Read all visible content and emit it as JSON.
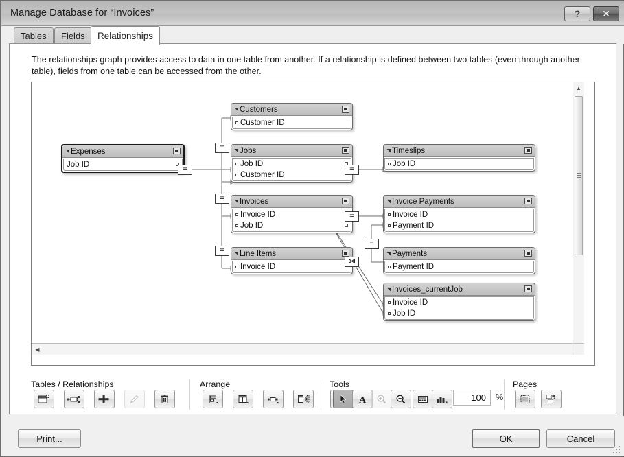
{
  "window": {
    "title": "Manage Database for “Invoices”",
    "help_label": "?",
    "close_label": "✕"
  },
  "tabs": [
    {
      "id": "tables",
      "label": "Tables",
      "active": false
    },
    {
      "id": "fields",
      "label": "Fields",
      "active": false
    },
    {
      "id": "relationships",
      "label": "Relationships",
      "active": true
    }
  ],
  "panel": {
    "description": "The relationships graph provides access to data in one table from another. If a relationship is defined between two tables (even through another table), fields from one table can be accessed from the other."
  },
  "graph": {
    "tables": [
      {
        "name": "Customers",
        "fields": [
          "Customer ID"
        ],
        "selected": false,
        "keyed": []
      },
      {
        "name": "Expenses",
        "fields": [
          "Job ID"
        ],
        "selected": true,
        "keyed": [
          "Job ID"
        ]
      },
      {
        "name": "Jobs",
        "fields": [
          "Job ID",
          "Customer ID"
        ],
        "selected": false,
        "keyed": [
          "Job ID"
        ]
      },
      {
        "name": "Timeslips",
        "fields": [
          "Job ID"
        ],
        "selected": false,
        "keyed": []
      },
      {
        "name": "Invoices",
        "fields": [
          "Invoice ID",
          "Job ID"
        ],
        "selected": false,
        "keyed": [
          "Invoice ID",
          "Job ID"
        ]
      },
      {
        "name": "Invoice Payments",
        "fields": [
          "Invoice ID",
          "Payment ID"
        ],
        "selected": false,
        "keyed": []
      },
      {
        "name": "Line Items",
        "fields": [
          "Invoice ID"
        ],
        "selected": false,
        "keyed": []
      },
      {
        "name": "Payments",
        "fields": [
          "Payment ID"
        ],
        "selected": false,
        "keyed": []
      },
      {
        "name": "Invoices_currentJob",
        "fields": [
          "Invoice ID",
          "Job ID"
        ],
        "selected": false,
        "keyed": []
      }
    ],
    "operators": [
      {
        "id": "op-expenses-jobs",
        "symbol": "="
      },
      {
        "id": "op-jobs-customers",
        "symbol": "="
      },
      {
        "id": "op-jobs-timeslips",
        "symbol": "="
      },
      {
        "id": "op-jobs-invoices",
        "symbol": "="
      },
      {
        "id": "op-invoices-lineitems",
        "symbol": "="
      },
      {
        "id": "op-invoices-invoicepayments",
        "symbol": "="
      },
      {
        "id": "op-invoicepayments-payments",
        "symbol": "="
      },
      {
        "id": "op-invoices-currentjob",
        "symbol": "⋈"
      }
    ]
  },
  "toolbar": {
    "groups": [
      {
        "id": "tables-relationships",
        "label": "Tables / Relationships"
      },
      {
        "id": "arrange",
        "label": "Arrange"
      },
      {
        "id": "tools",
        "label": "Tools"
      },
      {
        "id": "pages",
        "label": "Pages"
      }
    ],
    "buttons": [
      {
        "id": "add-table",
        "icon": "add-table-icon",
        "enabled": true,
        "active": false
      },
      {
        "id": "add-relationship",
        "icon": "add-relationship-icon",
        "enabled": true,
        "active": false
      },
      {
        "id": "duplicate-table",
        "icon": "duplicate-table-icon",
        "enabled": true,
        "active": false
      },
      {
        "id": "edit-table",
        "icon": "pencil-icon",
        "enabled": false,
        "active": false
      },
      {
        "id": "delete-table",
        "icon": "trash-icon",
        "enabled": true,
        "active": false
      },
      {
        "id": "align",
        "icon": "align-icon",
        "enabled": true,
        "active": false
      },
      {
        "id": "distribute",
        "icon": "distribute-icon",
        "enabled": true,
        "active": false
      },
      {
        "id": "resize",
        "icon": "resize-icon",
        "enabled": true,
        "active": false
      },
      {
        "id": "arrange-tables",
        "icon": "arrange-tables-icon",
        "enabled": true,
        "active": false
      },
      {
        "id": "color",
        "icon": "color-swatch-icon",
        "enabled": true,
        "active": false
      },
      {
        "id": "select-tool",
        "icon": "pointer-icon",
        "enabled": true,
        "active": true
      },
      {
        "id": "text-tool",
        "icon": "text-a-icon",
        "enabled": true,
        "active": false
      },
      {
        "id": "zoom-in-tool",
        "icon": "zoom-in-icon",
        "enabled": false,
        "active": false
      },
      {
        "id": "zoom-out-tool",
        "icon": "zoom-out-icon",
        "enabled": true,
        "active": false
      },
      {
        "id": "note-tool",
        "icon": "note-icon",
        "enabled": true,
        "active": false
      },
      {
        "id": "table-view-tool",
        "icon": "table-view-icon",
        "enabled": true,
        "active": false
      },
      {
        "id": "page-breaks",
        "icon": "page-breaks-icon",
        "enabled": true,
        "active": false
      },
      {
        "id": "page-setup",
        "icon": "page-setup-icon",
        "enabled": true,
        "active": false
      }
    ],
    "zoom": {
      "value": "100",
      "unit": "%"
    }
  },
  "footer": {
    "print": {
      "mnemonic": "P",
      "rest": "rint..."
    },
    "ok": "OK",
    "cancel": "Cancel"
  }
}
